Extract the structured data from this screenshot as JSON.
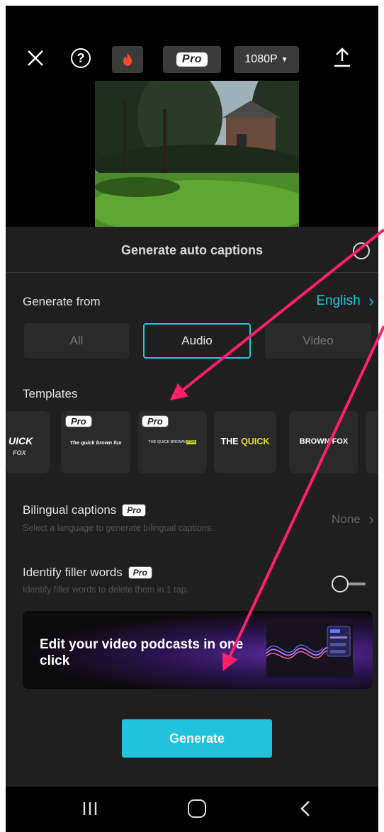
{
  "topbar": {
    "pro_label": "Pro",
    "resolution": "1080P",
    "icons": [
      "close-icon",
      "help-icon",
      "fire-icon",
      "export-icon"
    ]
  },
  "sheet": {
    "title": "Generate auto captions",
    "generate_from_label": "Generate from",
    "language": "English",
    "segments": [
      "All",
      "Audio",
      "Video"
    ],
    "selected_segment": "Audio",
    "templates_label": "Templates",
    "templates": [
      {
        "text": "UICK",
        "sub": "FOX",
        "pro": false
      },
      {
        "text": "The quick brown fox",
        "pro": true
      },
      {
        "text": "THE QUICK BROWN",
        "highlight": "FOX",
        "pro": true
      },
      {
        "text": "THE",
        "highlight": "QUICK",
        "pro": false
      },
      {
        "text": "BROWN F",
        "tail": "OX",
        "pro": false
      }
    ],
    "bilingual_label": "Bilingual captions",
    "bilingual_pro": "Pro",
    "bilingual_sub": "Select a language to generate bilingual captions.",
    "bilingual_value": "None",
    "filler_label": "Identify filler words",
    "filler_pro": "Pro",
    "filler_sub": "Identify filler words to delete them in 1 tap.",
    "filler_enabled": false,
    "banner_text": "Edit your video podcasts in one click",
    "generate_button": "Generate"
  },
  "colors": {
    "accent": "#23c6e0",
    "sheet_bg": "#1f1f1f",
    "annotation_arrow": "#ff1f6b"
  }
}
